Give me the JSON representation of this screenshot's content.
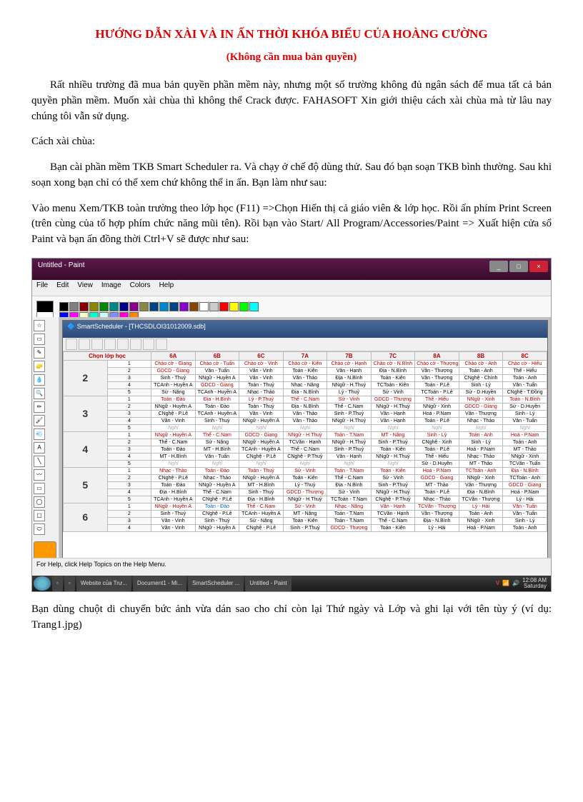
{
  "doc": {
    "title": "HƯỚNG DẪN XÀI VÀ IN ẤN THỜI KHÓA BIỂU CỦA HOÀNG CƯỜNG",
    "subtitle": "(Không cần mua bản quyền)",
    "p1": "Rất nhiều trường đã mua bản quyền phần mềm này, nhưng một số trường không đủ ngân sách để mua tất cả bản quyền phần mềm. Muốn xài chùa thì không thể Crack được. FAHASOFT Xin giới thiệu cách xài chùa mà từ lâu nay chúng tôi vẫn sử dụng.",
    "p2": "Cách xài chùa:",
    "p3": "Bạn cài phần mềm TKB Smart Scheduler ra. Và chạy ở chế độ dùng thử. Sau đó bạn soạn TKB bình thường. Sau khi soạn xong bạn chỉ có thể xem chứ không thể in ấn. Bạn làm như sau:",
    "p4": "Vào menu Xem/TKB toàn trường theo lớp học (F11) =>Chọn Hiển thị cả giáo viên & lớp học. Rồi ấn phím Print Screen (trên cùng của tổ hợp phím chức năng mũi tên). Rồi bạn vào Start/ All Program/Accessories/Paint  => Xuất hiện cửa sổ Paint và bạn ấn đồng thời Ctrl+V sẽ được như sau:",
    "p5": "Bạn dùng chuột di chuyển bức ảnh vừa dán sao cho chỉ còn lại Thứ ngày và Lớp và ghi lại với tên tùy ý (ví dụ: Trang1.jpg)"
  },
  "paint": {
    "title": "Untitled - Paint",
    "menu": [
      "File",
      "Edit",
      "View",
      "Image",
      "Colors",
      "Help"
    ],
    "status": "For Help, click Help Topics on the Help Menu.",
    "palette": [
      "#000",
      "#808080",
      "#800",
      "#880",
      "#080",
      "#088",
      "#008",
      "#808",
      "#884",
      "#048",
      "#08c",
      "#048",
      "#80c",
      "#840",
      "#fff",
      "#ccc",
      "#f00",
      "#ff0",
      "#0f0",
      "#0ff",
      "#00f",
      "#f0f",
      "#ffc",
      "#0fc",
      "#cff",
      "#88f",
      "#f0c",
      "#f80"
    ]
  },
  "inner": {
    "title": "SmartScheduler - [THCSDLOI31012009.sdb]",
    "corner": "Chọn lớp học"
  },
  "headers": [
    "6A",
    "6B",
    "6C",
    "7A",
    "7B",
    "7C",
    "8A",
    "8B",
    "8C"
  ],
  "days": [
    {
      "n": "2",
      "rows": [
        [
          "1",
          "Chào cờ - Giang",
          "Chào cờ - Tuấn",
          "Chào cờ - Vinh",
          "Chào cờ - Kiên",
          "Chào cờ - Hạnh",
          "Chào cờ - N.Bình",
          "Chào cờ - Thượng",
          "Chào cờ - Anh",
          "Chào cờ - Hiếu"
        ],
        [
          "2",
          "GDCD - Giang",
          "Văn - Tuấn",
          "Văn - Vinh",
          "Toán - Kiên",
          "Văn - Hạnh",
          "Địa - N.Bình",
          "Văn - Thượng",
          "Toán - Anh",
          "Thể - Hiếu"
        ],
        [
          "3",
          "Sinh - Thuỷ",
          "NNgữ - Huyền A",
          "Văn - Vinh",
          "Văn - Thảo",
          "Địa - N.Bình",
          "Toán - Kiên",
          "Văn - Thượng",
          "CNghệ - Chính",
          "Toán - Anh"
        ],
        [
          "4",
          "TCAnh - Huyền A",
          "GDCD - Giang",
          "Toán - Thuỷ",
          "Nhạc - Năng",
          "NNgữ - H.Thuỷ",
          "TCToán - Kiên",
          "Toán - P.Lê",
          "Sinh - Lý",
          "Văn - Tuấn"
        ],
        [
          "5",
          "Sử - Năng",
          "TCAnh - Huyền A",
          "Nhạc - Thảo",
          "Địa - N.Bình",
          "Lý - Thuỷ",
          "Sử - Vinh",
          "TCToán - P.Lê",
          "Sử - D.Huyền",
          "CNghệ - T.Đồng"
        ]
      ]
    },
    {
      "n": "3",
      "rows": [
        [
          "1",
          "Toán - Đào",
          "Địa - H.Bình",
          "Lý - P.Thuỷ",
          "Thể - C.Nam",
          "Sử - Vinh",
          "GDCD - Thượng",
          "Thể - Hiếu",
          "NNgữ - Xinh",
          "Toán - N.Bình"
        ],
        [
          "2",
          "NNgữ - Huyền A",
          "Toán - Đào",
          "Toán - Thuỷ",
          "Địa - N.Bình",
          "Thể - C.Nam",
          "NNgữ - H.Thuỷ",
          "NNgữ - Xinh",
          "GDCD - Giang",
          "Sử - D.Huyền"
        ],
        [
          "3",
          "CNghệ - P.Lê",
          "TCAnh - Huyền A",
          "Văn - Vinh",
          "Văn - Thảo",
          "Sinh - P.Thuỷ",
          "Văn - Hạnh",
          "Hoá - P.Nam",
          "Văn - Thượng",
          "Sinh - Lý"
        ],
        [
          "4",
          "Văn - Vinh",
          "Sinh - Thuỷ",
          "NNgữ - Huyền A",
          "Văn - Thảo",
          "NNgữ - H.Thuỷ",
          "Văn - Hạnh",
          "Toán - P.Lê",
          "Nhạc - Thảo",
          "Văn - Tuấn"
        ],
        [
          "5",
          "Nghỉ",
          "Nghỉ",
          "Nghỉ",
          "Nghỉ",
          "Nghỉ",
          "Nghỉ",
          "Nghỉ",
          "Nghỉ",
          "Nghỉ"
        ]
      ]
    },
    {
      "n": "4",
      "rows": [
        [
          "1",
          "NNgữ - Huyền A",
          "Thể - C.Nam",
          "GDCD - Giang",
          "NNgữ - H.Thuỷ",
          "Toán - T.Nam",
          "MT - Năng",
          "Sinh - Lý",
          "Toán - Anh",
          "Hoá - P.Nam"
        ],
        [
          "2",
          "Thể - C.Nam",
          "Sử - Năng",
          "NNgữ - Huyền A",
          "TCVăn - Hạnh",
          "NNgữ - H.Thuỷ",
          "Sinh - P.Thuỷ",
          "CNghệ - Xinh",
          "Sinh - Lý",
          "Toán - Anh"
        ],
        [
          "3",
          "Toán - Đào",
          "MT - H.Bình",
          "TCAnh - Huyền A",
          "Thể - C.Nam",
          "Sinh - P.Thuỷ",
          "Toán - Kiên",
          "Toán - P.Lê",
          "Hoá - P.Nam",
          "MT - Thảo"
        ],
        [
          "4",
          "MT - H.Bình",
          "Văn - Tuấn",
          "CNghệ - P.Lê",
          "CNghệ - P.Thuỷ",
          "Văn - Hạnh",
          "NNgữ - H.Thuỷ",
          "Thể - Hiếu",
          "Nhạc - Thảo",
          "NNgữ - Xinh"
        ],
        [
          "5",
          "Nghỉ",
          "Nghỉ",
          "Nghỉ",
          "Nghỉ",
          "Nghỉ",
          "Nghỉ",
          "Sử - D.Huyền",
          "MT - Thảo",
          "TCVăn - Tuấn"
        ]
      ]
    },
    {
      "n": "5",
      "rows": [
        [
          "1",
          "Nhạc - Thảo",
          "Toán - Đào",
          "Toán - Thuỷ",
          "Sử - Vinh",
          "Toán - T.Nam",
          "Toán - Kiên",
          "Hoá - P.Nam",
          "TCToán - Anh",
          "Địa - N.Bình"
        ],
        [
          "2",
          "CNghệ - P.Lê",
          "Nhạc - Thảo",
          "NNgữ - Huyền A",
          "Toán - Kiên",
          "Thể - C.Nam",
          "Sử - Vinh",
          "GDCD - Giang",
          "NNgữ - Xinh",
          "TCToán - Anh"
        ],
        [
          "3",
          "Toán - Đào",
          "NNgữ - Huyền A",
          "MT - H.Bình",
          "Lý - Thuỷ",
          "Địa - N.Bình",
          "Sinh - P.Thuỷ",
          "MT - Thảo",
          "Văn - Thượng",
          "GDCD - Giang"
        ],
        [
          "4",
          "Địa - H.Bình",
          "Thể - C.Nam",
          "Sinh - Thuỷ",
          "GDCD - Thượng",
          "Sử - Vinh",
          "NNgữ - H.Thuỷ",
          "Toán - P.Lê",
          "Địa - N.Bình",
          "Hoá - P.Nam"
        ],
        [
          "5",
          "TCAnh - Huyền A",
          "CNghệ - P.Lê",
          "Địa - H.Bình",
          "NNgữ - H.Thuỷ",
          "TCToán - T.Nam",
          "CNghệ - P.Thuỷ",
          "Nhạc - Thảo",
          "TCVăn - Thượng",
          "Lý - Hải"
        ]
      ]
    },
    {
      "n": "6",
      "rows": [
        [
          "1",
          "NNgữ - Huyền A",
          "Toán - Đào",
          "Thể - C.Nam",
          "Sử - Vinh",
          "Nhạc - Năng",
          "Văn - Hạnh",
          "TCVăn - Thượng",
          "Lý - Hải",
          "Văn - Tuấn"
        ],
        [
          "2",
          "Sinh - Thuỷ",
          "CNghệ - P.Lê",
          "TCAnh - Huyền A",
          "MT - Năng",
          "Toán - T.Nam",
          "TCVăn - Hạnh",
          "Văn - Thượng",
          "Toán - Anh",
          "Văn - Tuấn"
        ],
        [
          "3",
          "Văn - Vinh",
          "Sinh - Thuỷ",
          "Sử - Năng",
          "Toán - Kiên",
          "Toán - T.Nam",
          "Thể - C.Nam",
          "Địa - N.Bình",
          "NNgữ - Xinh",
          "Sinh - Lý"
        ],
        [
          "4",
          "Văn - Vinh",
          "NNgữ - Huyền A",
          "CNghệ - P.Lê",
          "Sinh - P.Thuỷ",
          "GDCD - Thượng",
          "Toán - Kiên",
          "Lý - Hải",
          "Hoá - P.Nam",
          "Toán - Anh"
        ]
      ]
    }
  ],
  "taskbar": {
    "items": [
      "",
      "",
      "Website của Trư...",
      "Document1 - Mi...",
      "SmartScheduler ...",
      "Untitled - Paint"
    ],
    "time": "12:08 AM",
    "date": "Saturday"
  }
}
